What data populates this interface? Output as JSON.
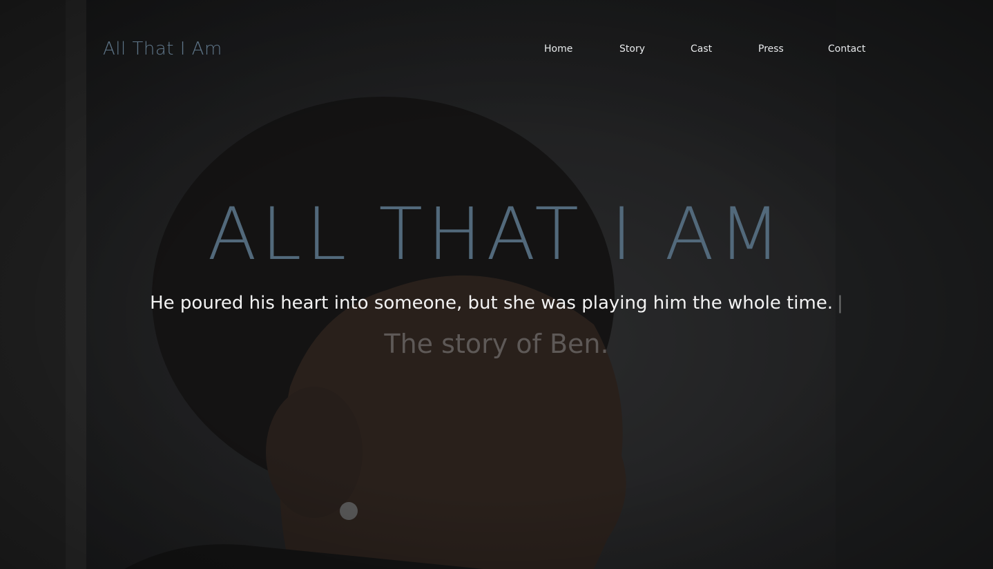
{
  "site": {
    "logo_text": "All That I Am"
  },
  "nav": {
    "items": [
      {
        "label": "Home"
      },
      {
        "label": "Story"
      },
      {
        "label": "Cast"
      },
      {
        "label": "Press"
      },
      {
        "label": "Contact"
      }
    ]
  },
  "hero": {
    "title": "ALL THAT I AM",
    "tagline": "He poured his heart into someone, but she was playing him the whole time.",
    "cursor": "|",
    "subline": "The story of Ben."
  },
  "colors": {
    "accent": "#52697b",
    "logo": "#5f7689",
    "nav_text": "#e8eaec",
    "background": "#2a2b2d"
  }
}
